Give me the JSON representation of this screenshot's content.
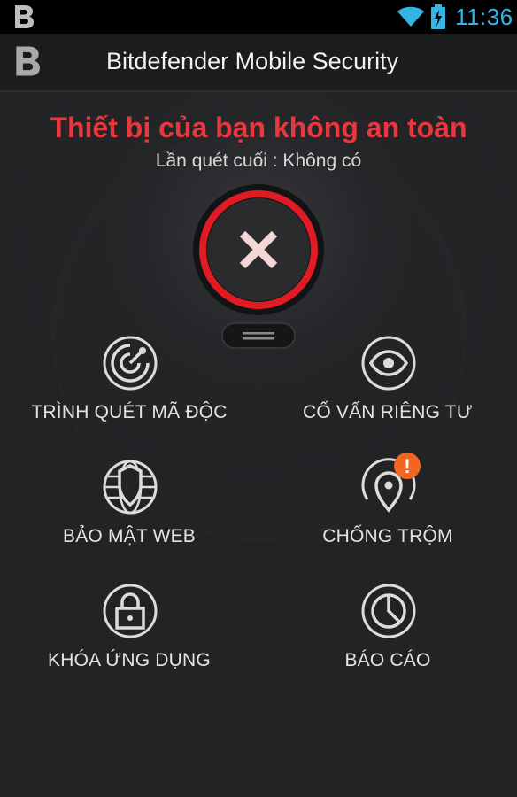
{
  "status_bar": {
    "time": "11:36",
    "icons": [
      "bitdefender-b-icon",
      "wifi-icon",
      "battery-charging-icon"
    ]
  },
  "action_bar": {
    "title": "Bitdefender Mobile Security"
  },
  "status": {
    "headline": "Thiết bị của bạn không an toàn",
    "last_scan": "Lần quét cuối : Không có",
    "indicator": "x-icon"
  },
  "features": [
    {
      "label": "TRÌNH QUÉT MÃ ĐỘC",
      "icon": "scanner-icon"
    },
    {
      "label": "CỐ VẤN RIÊNG TƯ",
      "icon": "eye-icon"
    },
    {
      "label": "BẢO MẬT WEB",
      "icon": "globe-shield-icon"
    },
    {
      "label": "CHỐNG TRỘM",
      "icon": "location-pin-icon",
      "badge": "!"
    },
    {
      "label": "KHÓA ỨNG DỤNG",
      "icon": "lock-icon"
    },
    {
      "label": "BÁO CÁO",
      "icon": "pie-chart-icon"
    }
  ],
  "colors": {
    "alert": "#e8373e",
    "accent_time": "#33b5e5",
    "badge": "#f26522",
    "background": "#222325"
  }
}
